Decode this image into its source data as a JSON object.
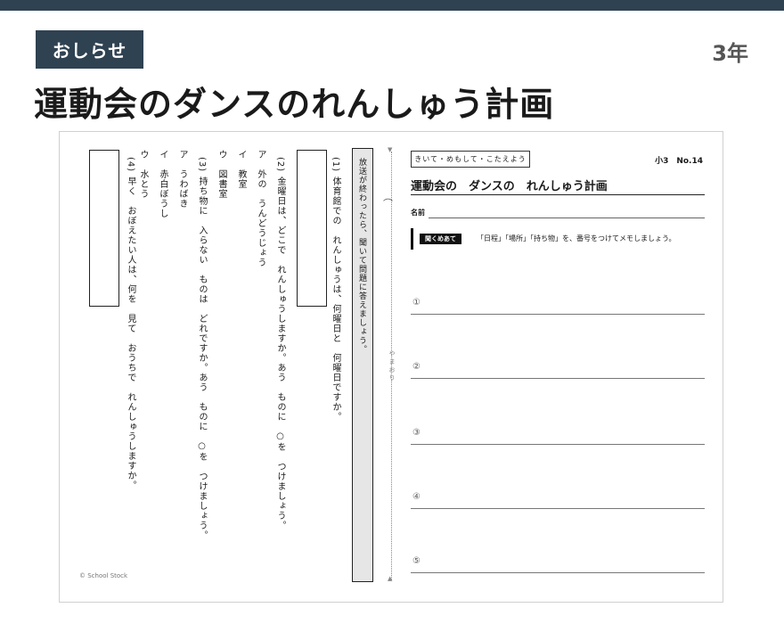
{
  "header": {
    "badge": "おしらせ",
    "grade": "3年",
    "title": "運動会のダンスのれんしゅう計画"
  },
  "worksheet": {
    "instruction": "放送が終わったら、聞いて問題に答えましょう。",
    "questions": [
      {
        "number": "(1)",
        "lines": [
          "体育館での　れんしゅうは、何曜日と　何曜日ですか。"
        ]
      },
      {
        "number": "(2)",
        "lines": [
          "金曜日は、どこで　れんしゅうしますか。あう　ものに　○を　つけましょう。"
        ],
        "choices": [
          "ア　外の　うんどうじょう",
          "イ　教室",
          "ウ　図書室"
        ]
      },
      {
        "number": "(3)",
        "lines": [
          "持ち物に　入らない　ものは　どれですか。あう　ものに　○を　つけましょう。"
        ],
        "choices": [
          "ア　うわばき",
          "イ　赤白ぼうし",
          "ウ　水とう"
        ]
      },
      {
        "number": "(4)",
        "lines": [
          "早く　おぼえたい人は、何を　見て　おうちで　れんしゅうしますか。"
        ]
      }
    ],
    "fold_label": "やまおり",
    "copyright": "© School Stock",
    "memo": {
      "tag": "きいて・めもして・こたえよう",
      "number": "小3　No.14",
      "title": "運動会の　ダンスの　れんしゅう計画",
      "name_label": "名前",
      "goal_tag": "聞くめあて",
      "goal_text": "「日程」「場所」「持ち物」を、番号をつけてメモしましょう。",
      "items": [
        "①",
        "②",
        "③",
        "④",
        "⑤"
      ]
    }
  }
}
